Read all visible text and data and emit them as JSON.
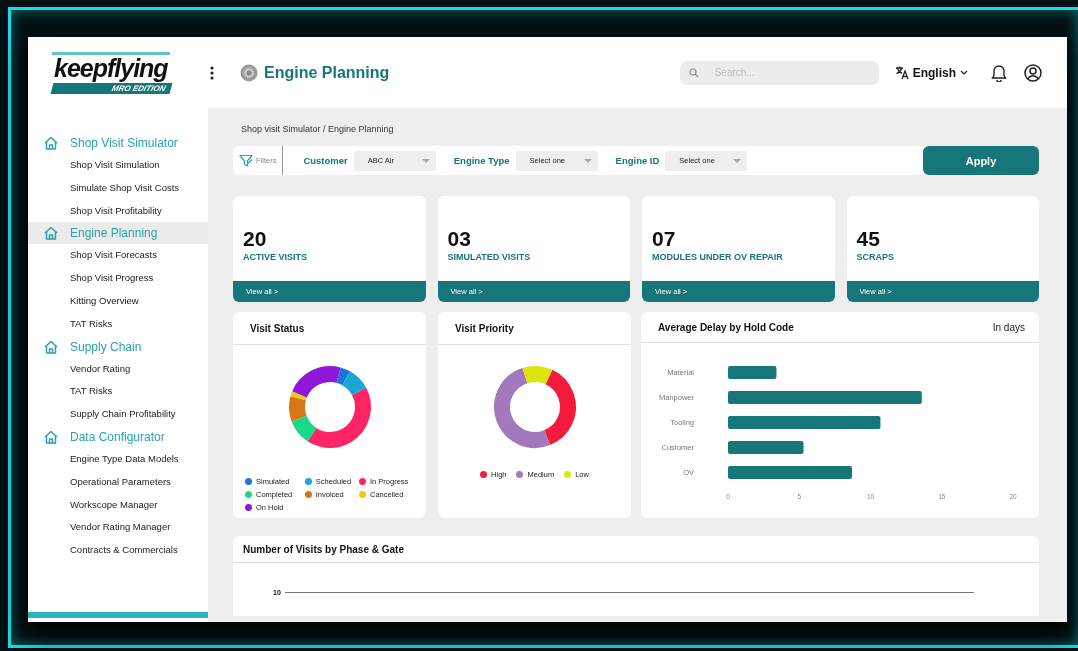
{
  "header": {
    "logo": {
      "wordmark": "keepflying",
      "edition": "MRO EDITION"
    },
    "page_title": "Engine Planning",
    "search": {
      "placeholder": "Search..."
    },
    "language": "English"
  },
  "sidebar": {
    "groups": [
      {
        "title": "Shop Visit Simulator",
        "selected": false,
        "items": [
          "Shop Visit Simulation",
          "Simulate Shop Visit Costs",
          "Shop Visit Profitability"
        ]
      },
      {
        "title": "Engine Planning",
        "selected": true,
        "items": [
          "Shop Visit Forecasts",
          "Shop Visit Progress",
          "Kitting Overview",
          "TAT Risks"
        ]
      },
      {
        "title": "Supply Chain",
        "selected": false,
        "items": [
          "Vendor Rating",
          "TAT Risks",
          "Supply Chain Profitability"
        ]
      },
      {
        "title": "Data Configurator",
        "selected": false,
        "items": [
          "Engine Type Data Models",
          "Operational Parameters",
          "Workscope Manager",
          "Vendor Rating Manager",
          "Contracts & Commercials"
        ]
      }
    ]
  },
  "breadcrumb": "Shop visit Simulator / Engine Planning",
  "filters": {
    "label": "Filters",
    "fields": [
      {
        "label": "Customer",
        "value": "ABC Air"
      },
      {
        "label": "Engine Type",
        "value": "Select one"
      },
      {
        "label": "Engine ID",
        "value": "Select one"
      }
    ],
    "apply": "Apply"
  },
  "stats": [
    {
      "value": "20",
      "label": "ACTIVE VISITS",
      "link": "View all >"
    },
    {
      "value": "03",
      "label": "SIMULATED VISITS",
      "link": "View all >"
    },
    {
      "value": "07",
      "label": "MODULES UNDER OV REPAIR",
      "link": "View all >"
    },
    {
      "value": "45",
      "label": "SCRAPS",
      "link": "View all >"
    }
  ],
  "visit_status": {
    "title": "Visit Status",
    "legend": [
      {
        "label": "Simulated",
        "color": "#1f74d8"
      },
      {
        "label": "Scheduled",
        "color": "#1aa6d6"
      },
      {
        "label": "In Progress",
        "color": "#fe2565"
      },
      {
        "label": "Completed",
        "color": "#18d98b"
      },
      {
        "label": "Invoiced",
        "color": "#d87518"
      },
      {
        "label": "Cancelled",
        "color": "#f0cc0a"
      },
      {
        "label": "On Hold",
        "color": "#8f18d8"
      }
    ]
  },
  "visit_priority": {
    "title": "Visit Priority",
    "legend": [
      {
        "label": "High",
        "color": "#f41a3c"
      },
      {
        "label": "Medium",
        "color": "#a478bd"
      },
      {
        "label": "Low",
        "color": "#dde50c"
      }
    ]
  },
  "delay_chart": {
    "title": "Average Delay by Hold Code",
    "unit": "In days",
    "chart_data": {
      "type": "bar",
      "orientation": "horizontal",
      "categories": [
        "Material",
        "Manpower",
        "Tooling",
        "Customer",
        "OV"
      ],
      "values": [
        3.4,
        13.6,
        10.7,
        5.3,
        8.7
      ],
      "xlim": [
        0,
        20
      ],
      "xticks": [
        0,
        5,
        10,
        15,
        20
      ]
    }
  },
  "phase_chart": {
    "title": "Number of Visits by Phase & Gate",
    "tick": "10"
  }
}
